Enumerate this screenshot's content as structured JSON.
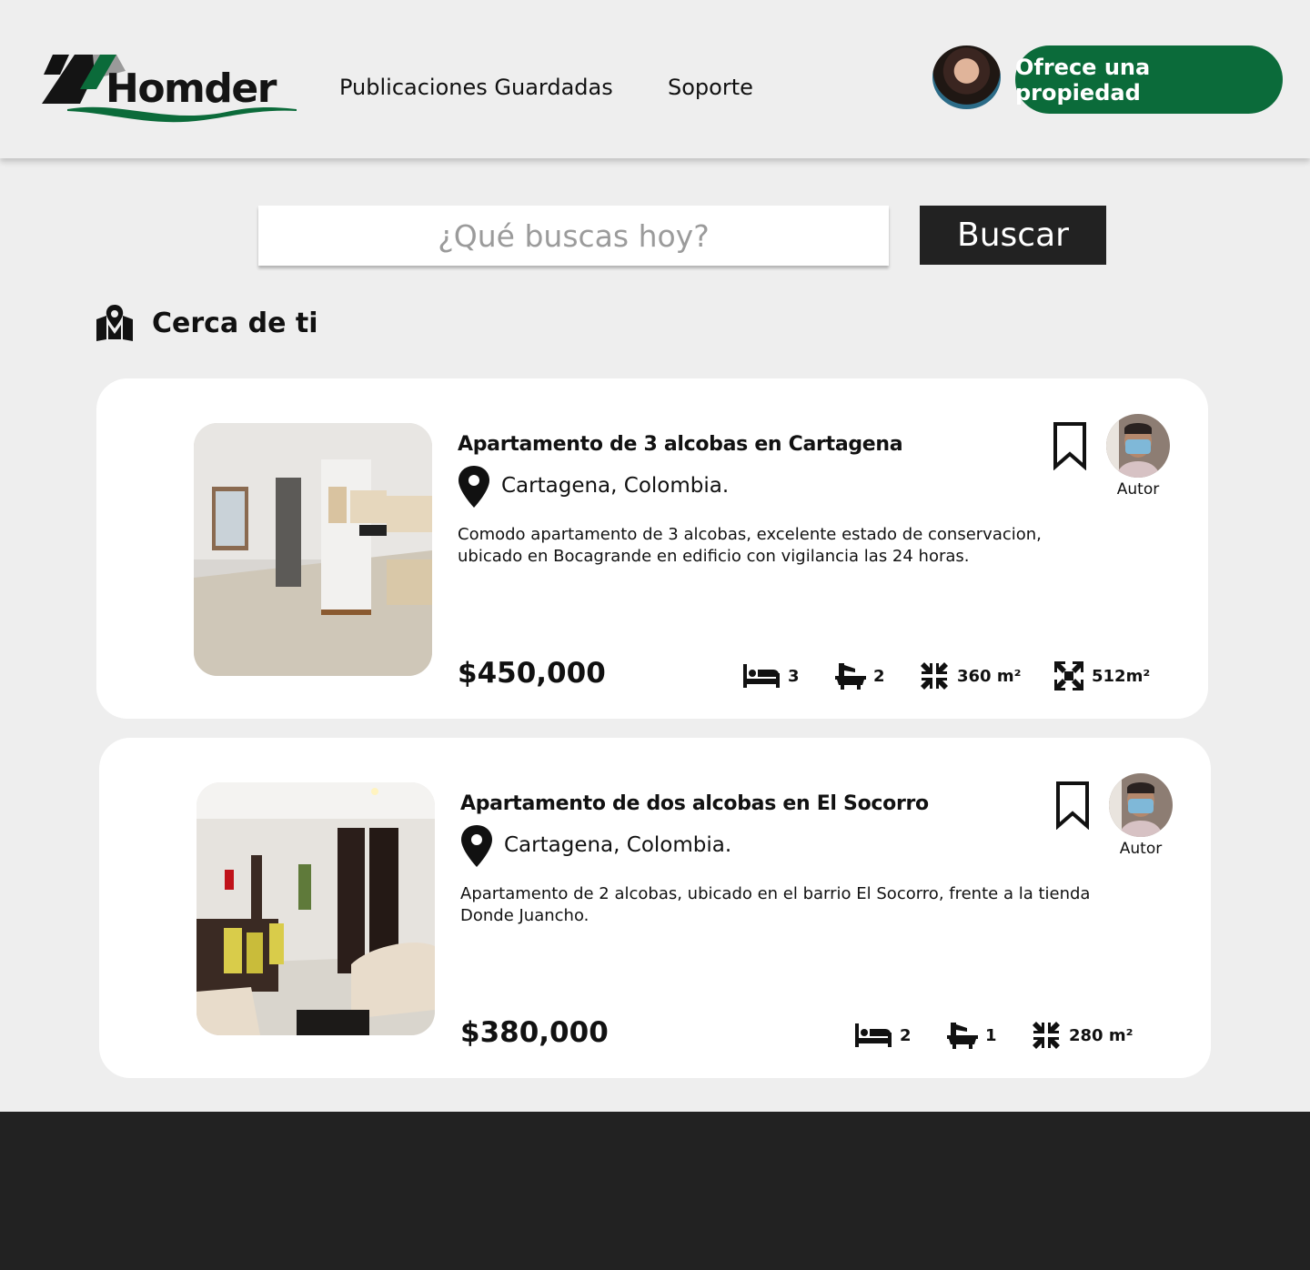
{
  "header": {
    "logo_text": "Homder",
    "nav": {
      "saved": "Publicaciones Guardadas",
      "support": "Soporte"
    },
    "cta_label": "Ofrece una propiedad"
  },
  "search": {
    "placeholder": "¿Qué buscas hoy?",
    "value": "",
    "button_label": "Buscar"
  },
  "section": {
    "icon": "map-pin-icon",
    "title": "Cerca de ti"
  },
  "listings": [
    {
      "title": "Apartamento de 3 alcobas en Cartagena",
      "location": "Cartagena, Colombia.",
      "description": "Comodo apartamento de 3 alcobas, excelente estado de conservacion, ubicado en Bocagrande en edificio con vigilancia las 24 horas.",
      "price": "$450,000",
      "author_label": "Autor",
      "bedrooms": "3",
      "bathrooms": "2",
      "built_area": "360 m²",
      "lot_area": "512m²"
    },
    {
      "title": "Apartamento de dos alcobas en El Socorro",
      "location": "Cartagena, Colombia.",
      "description": "Apartamento de 2 alcobas, ubicado en el barrio El Socorro,  frente a la tienda Donde Juancho.",
      "price": "$380,000",
      "author_label": "Autor",
      "bedrooms": "2",
      "bathrooms": "1",
      "built_area": "280 m²"
    }
  ],
  "colors": {
    "brand_green": "#0b6b3a",
    "background": "#eeeeee",
    "dark": "#222222"
  }
}
